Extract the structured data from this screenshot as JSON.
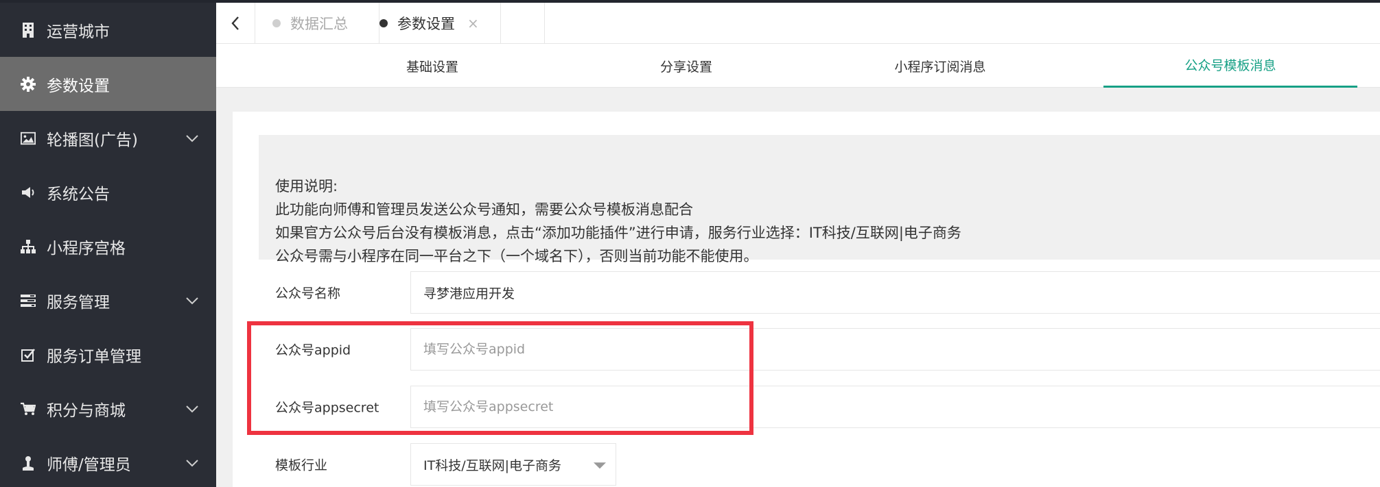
{
  "sidebar": {
    "items": [
      {
        "label": "运营城市",
        "icon": "building-icon",
        "active": false,
        "expandable": false
      },
      {
        "label": "参数设置",
        "icon": "gear-icon",
        "active": true,
        "expandable": false
      },
      {
        "label": "轮播图(广告)",
        "icon": "image-icon",
        "active": false,
        "expandable": true
      },
      {
        "label": "系统公告",
        "icon": "megaphone-icon",
        "active": false,
        "expandable": false
      },
      {
        "label": "小程序宫格",
        "icon": "sitemap-icon",
        "active": false,
        "expandable": false
      },
      {
        "label": "服务管理",
        "icon": "tasks-icon",
        "active": false,
        "expandable": true
      },
      {
        "label": "服务订单管理",
        "icon": "check-square-icon",
        "active": false,
        "expandable": false
      },
      {
        "label": "积分与商城",
        "icon": "cart-icon",
        "active": false,
        "expandable": true
      },
      {
        "label": "师傅/管理员",
        "icon": "user-icon",
        "active": false,
        "expandable": true
      }
    ]
  },
  "tabs": {
    "back_icon": "chevron-left-icon",
    "items": [
      {
        "label": "数据汇总",
        "active": false
      },
      {
        "label": "参数设置",
        "active": true,
        "close": "×"
      }
    ]
  },
  "subtabs": {
    "items": [
      {
        "label": "基础设置",
        "active": false
      },
      {
        "label": "分享设置",
        "active": false
      },
      {
        "label": "小程序订阅消息",
        "active": false
      },
      {
        "label": "公众号模板消息",
        "active": true
      }
    ]
  },
  "notice": {
    "lines": [
      "使用说明:",
      "此功能向师傅和管理员发送公众号通知，需要公众号模板消息配合",
      "如果官方公众号后台没有模板消息，点击“添加功能插件”进行申请，服务行业选择：IT科技/互联网|电子商务",
      "公众号需与小程序在同一平台之下（一个域名下），否则当前功能不能使用。"
    ]
  },
  "form": {
    "name": {
      "label": "公众号名称",
      "value": "寻梦港应用开发"
    },
    "appid": {
      "label": "公众号appid",
      "value": "",
      "placeholder": "填写公众号appid"
    },
    "appsecret": {
      "label": "公众号appsecret",
      "value": "",
      "placeholder": "填写公众号appsecret"
    },
    "industry": {
      "label": "模板行业",
      "value": "IT科技/互联网|电子商务"
    }
  },
  "colors": {
    "sidebar_bg": "#2a2d35",
    "sidebar_active": "#6c6c6c",
    "accent": "#16a085",
    "highlight": "#ee3340"
  }
}
